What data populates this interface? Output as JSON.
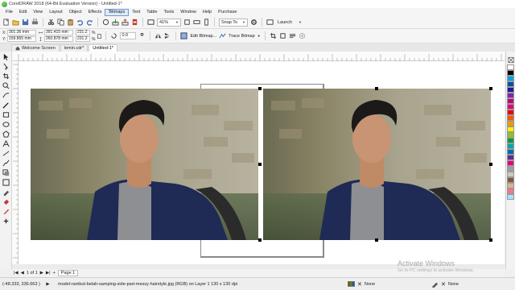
{
  "window": {
    "title": "CorelDRAW 2018 (64-Bit Evaluation Version) - Untitled-1*"
  },
  "menu": [
    {
      "label": "File",
      "active": false
    },
    {
      "label": "Edit",
      "active": false
    },
    {
      "label": "View",
      "active": false
    },
    {
      "label": "Layout",
      "active": false
    },
    {
      "label": "Object",
      "active": false
    },
    {
      "label": "Effects",
      "active": false
    },
    {
      "label": "Bitmaps",
      "active": true
    },
    {
      "label": "Text",
      "active": false
    },
    {
      "label": "Table",
      "active": false
    },
    {
      "label": "Tools",
      "active": false
    },
    {
      "label": "Window",
      "active": false
    },
    {
      "label": "Help",
      "active": false
    },
    {
      "label": "Purchase",
      "active": false
    }
  ],
  "toolbar": {
    "zoom_value": "41%",
    "snap_label": "Snap To",
    "launch_label": "Launch"
  },
  "propertybar": {
    "x_label": "X:",
    "y_label": "Y:",
    "x_value": "301.36 mm",
    "y_value": "159.855 mm",
    "w_value": "391.415 mm",
    "h_value": "260.878 mm",
    "scale_x": "231.2",
    "scale_y": "231.2",
    "percent": "%",
    "rotation": "0.0",
    "edit_bitmap_label": "Edit Bitmap...",
    "trace_bitmap_label": "Trace Bitmap"
  },
  "tabs": [
    {
      "label": "Welcome Screen",
      "active": false
    },
    {
      "label": "lemin.cdr*",
      "active": false
    },
    {
      "label": "Untitled-1*",
      "active": true
    }
  ],
  "pagenav": {
    "counter": "1 of 1",
    "page_tab": "Page 1"
  },
  "status": {
    "coords": "(-48.333, 336.663 )",
    "info": "model-rambut-belah-samping-side-part-messy-hairstyle.jpg (RGB) on Layer 1 130 x 130 dpi",
    "fill_none": "None",
    "outline_none": "None"
  },
  "overlay": {
    "watermark_title": "Activate Windows",
    "watermark_sub": "Go to PC settings to activate Windows."
  },
  "palette_colors": [
    "#ffffff",
    "#000000",
    "#00a0e9",
    "#0050a0",
    "#1a1aa0",
    "#7a2aa0",
    "#c00080",
    "#e0007a",
    "#e60012",
    "#f05a00",
    "#f39800",
    "#fff100",
    "#8fc31f",
    "#009944",
    "#00a99d",
    "#0068b7",
    "#5b2d8e",
    "#e4007f",
    "#9e9e9e",
    "#c9c9c9",
    "#7d5a3c",
    "#d9b38c",
    "#ff6f91",
    "#a8e0ff"
  ]
}
